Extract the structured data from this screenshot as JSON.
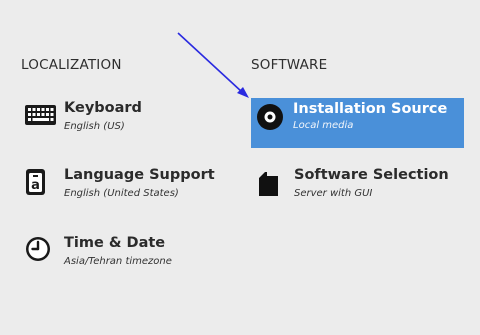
{
  "localization": {
    "title": "LOCALIZATION",
    "items": [
      {
        "label": "Keyboard",
        "status": "English (US)",
        "icon": "keyboard-icon"
      },
      {
        "label": "Language Support",
        "status": "English (United States)",
        "icon": "language-icon"
      },
      {
        "label": "Time & Date",
        "status": "Asia/Tehran timezone",
        "icon": "clock-icon"
      }
    ]
  },
  "software": {
    "title": "SOFTWARE",
    "items": [
      {
        "label": "Installation Source",
        "status": "Local media",
        "icon": "disc-icon",
        "selected": true
      },
      {
        "label": "Software Selection",
        "status": "Server with GUI",
        "icon": "package-icon"
      }
    ]
  },
  "colors": {
    "background": "#ececec",
    "selection": "#4a90d9",
    "annotation_arrow": "#2a2ae0"
  }
}
